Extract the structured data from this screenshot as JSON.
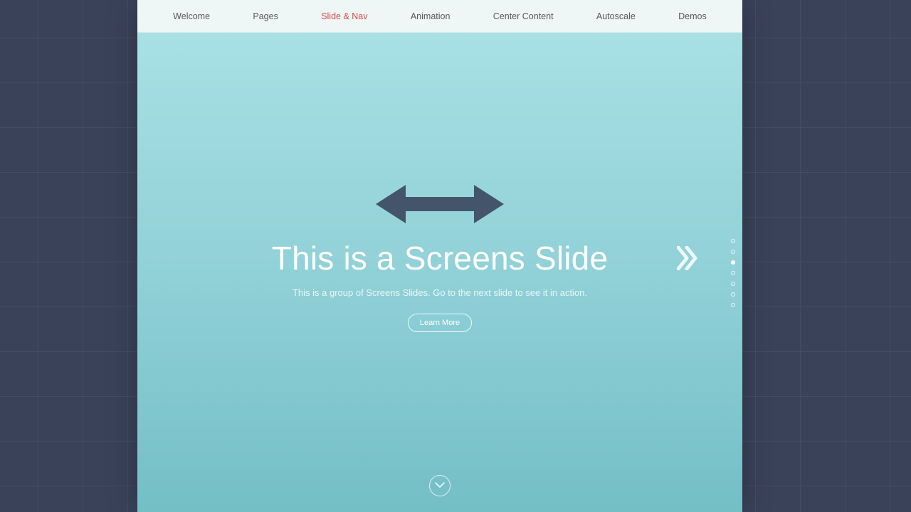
{
  "nav": {
    "items": [
      {
        "label": "Welcome",
        "active": false
      },
      {
        "label": "Pages",
        "active": false
      },
      {
        "label": "Slide & Nav",
        "active": true
      },
      {
        "label": "Animation",
        "active": false
      },
      {
        "label": "Center Content",
        "active": false
      },
      {
        "label": "Autoscale",
        "active": false
      },
      {
        "label": "Demos",
        "active": false
      }
    ]
  },
  "slide": {
    "title": "This is a Screens Slide",
    "subtitle": "This is a group of Screens Slides. Go to the next slide to see it in action.",
    "cta_label": "Learn More"
  },
  "pager": {
    "total_dots": 7,
    "active_index": 2
  },
  "colors": {
    "nav_active": "#d94a4a",
    "arrow_dark": "#44546a"
  }
}
